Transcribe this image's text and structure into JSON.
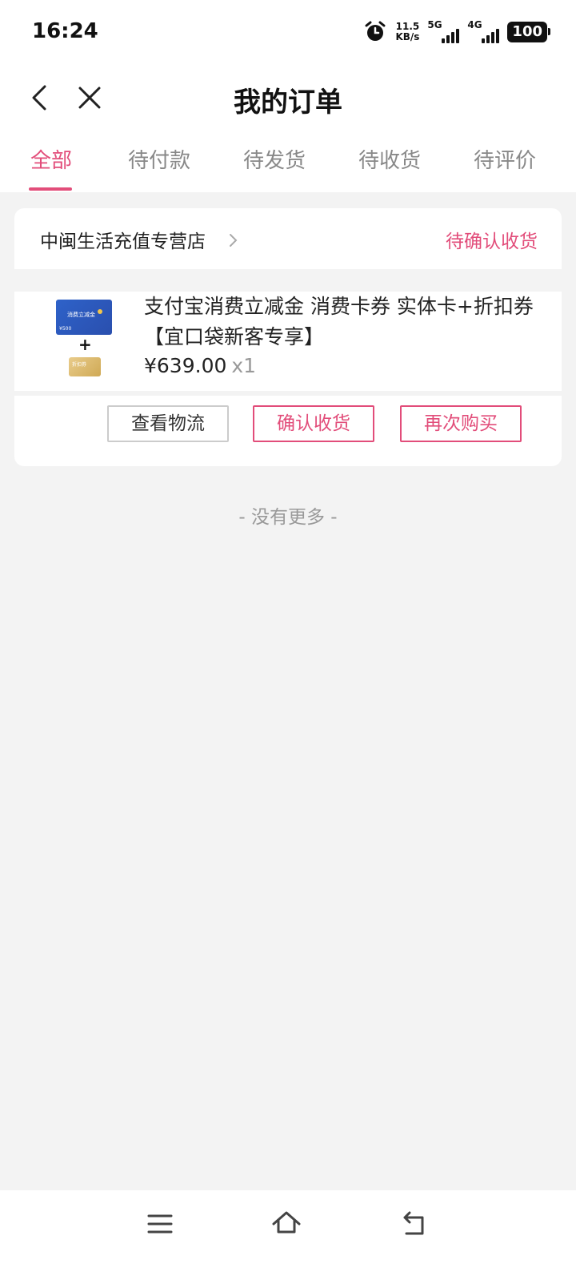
{
  "status_bar": {
    "time": "16:24",
    "net_speed_value": "11.5",
    "net_speed_unit": "KB/s",
    "net_1": "5G",
    "net_2": "4G",
    "battery": "100"
  },
  "header": {
    "title": "我的订单"
  },
  "tabs": [
    {
      "label": "全部",
      "active": true
    },
    {
      "label": "待付款",
      "active": false
    },
    {
      "label": "待发货",
      "active": false
    },
    {
      "label": "待收货",
      "active": false
    },
    {
      "label": "待评价",
      "active": false
    }
  ],
  "orders": [
    {
      "store_name": "中闽生活充值专营店",
      "status": "待确认收货",
      "product": {
        "title": "支付宝消费立减金 消费卡券 实体卡+折扣券【宜口袋新客专享】",
        "price": "¥639.00",
        "quantity": "x1",
        "thumb_card_text": "消费立减金",
        "thumb_card_value": "¥500",
        "thumb_coupon_text": "折扣券"
      },
      "actions": {
        "logistics": "查看物流",
        "confirm": "确认收货",
        "rebuy": "再次购买"
      }
    }
  ],
  "footer": {
    "no_more": "- 没有更多 -"
  },
  "colors": {
    "accent": "#e24d7a",
    "background": "#f3f3f3"
  },
  "icons": {
    "back": "back-icon",
    "close": "close-icon",
    "menu": "menu-icon",
    "home": "home-icon",
    "return": "return-icon"
  }
}
